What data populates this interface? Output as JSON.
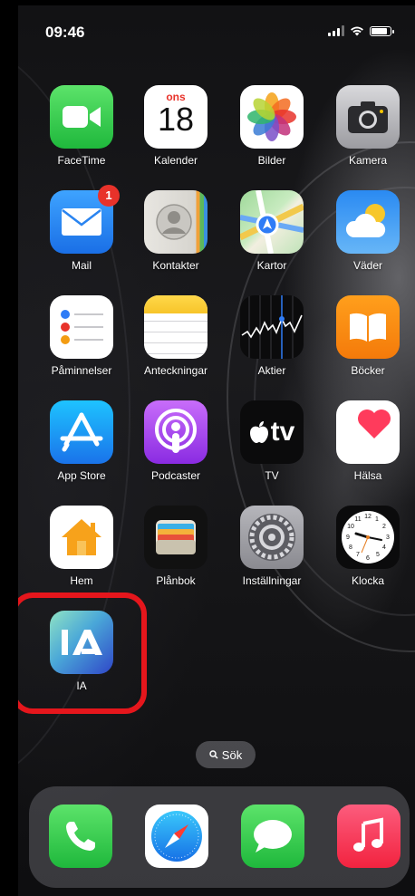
{
  "status_bar": {
    "time": "09:46",
    "battery_level": 0.9
  },
  "apps": [
    {
      "label": "FaceTime",
      "icon": "facetime-icon"
    },
    {
      "label": "Kalender",
      "icon": "calendar-icon",
      "weekday": "ons",
      "day": "18"
    },
    {
      "label": "Bilder",
      "icon": "photos-icon"
    },
    {
      "label": "Kamera",
      "icon": "camera-icon"
    },
    {
      "label": "Mail",
      "icon": "mail-icon",
      "badge": "1"
    },
    {
      "label": "Kontakter",
      "icon": "contacts-icon"
    },
    {
      "label": "Kartor",
      "icon": "maps-icon"
    },
    {
      "label": "Väder",
      "icon": "weather-icon"
    },
    {
      "label": "Påminnelser",
      "icon": "reminders-icon"
    },
    {
      "label": "Anteckningar",
      "icon": "notes-icon"
    },
    {
      "label": "Aktier",
      "icon": "stocks-icon"
    },
    {
      "label": "Böcker",
      "icon": "books-icon"
    },
    {
      "label": "App Store",
      "icon": "app-store-icon"
    },
    {
      "label": "Podcaster",
      "icon": "podcasts-icon"
    },
    {
      "label": "TV",
      "icon": "apple-tv-icon",
      "icon_text": "tv"
    },
    {
      "label": "Hälsa",
      "icon": "health-icon"
    },
    {
      "label": "Hem",
      "icon": "home-icon"
    },
    {
      "label": "Plånbok",
      "icon": "wallet-icon"
    },
    {
      "label": "Inställningar",
      "icon": "settings-icon"
    },
    {
      "label": "Klocka",
      "icon": "clock-icon"
    },
    {
      "label": "IA",
      "icon": "ia-icon",
      "icon_text": "IA"
    }
  ],
  "search": {
    "label": "Sök"
  },
  "dock": [
    {
      "icon": "phone-icon"
    },
    {
      "icon": "safari-icon"
    },
    {
      "icon": "messages-icon"
    },
    {
      "icon": "music-icon"
    }
  ],
  "colors": {
    "highlight": "#e5161c",
    "badge": "#e8322a"
  }
}
